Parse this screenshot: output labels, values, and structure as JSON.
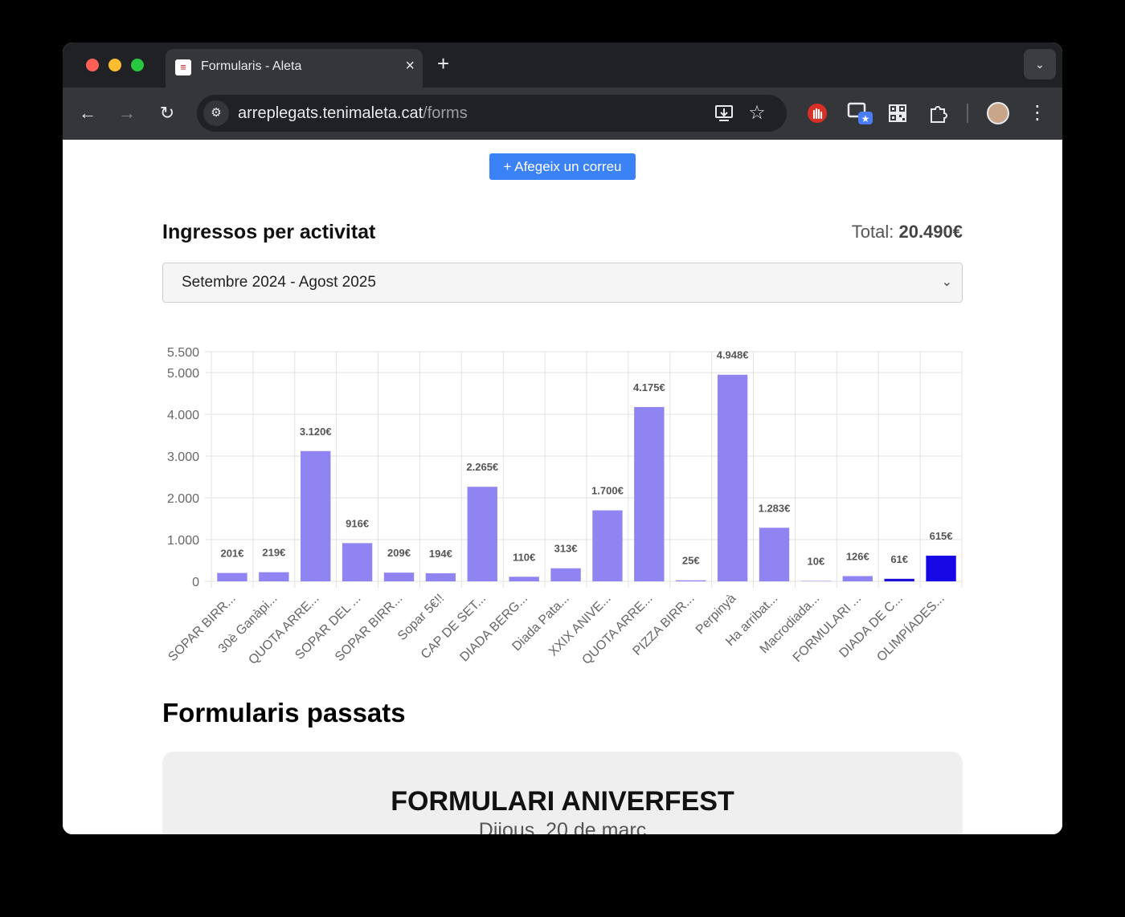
{
  "browser": {
    "tab_title": "Formularis - Aleta",
    "url_host": "arreplegats.tenimaleta.cat",
    "url_path": "/forms",
    "favicon_glyph": "≡"
  },
  "page": {
    "add_button": "+ Afegeix un correu",
    "section_title": "Ingressos per activitat",
    "total_label": "Total:",
    "total_value": "20.490€",
    "period_selected": "Setembre 2024 - Agost 2025",
    "past_title": "Formularis passats",
    "card": {
      "title": "FORMULARI ANIVERFEST",
      "date": "Dijous, 20 de març"
    }
  },
  "colors": {
    "bar": "#8f84f1",
    "bar_dark": "#1d0fd8",
    "bar_last": "#1808e6",
    "accent_button": "#3b82f6"
  },
  "chart_data": {
    "type": "bar",
    "categories": [
      "SOPAR BIRR...",
      "30è Ganàpi...",
      "QUOTA ARRE...",
      "SOPAR DEL ...",
      "SOPAR BIRR...",
      "Sopar 5€!!",
      "CAP DE SET...",
      "DIADA BERG...",
      "Diada Pata...",
      "XXIX ANIVE...",
      "QUOTA ARRE...",
      "PIZZA BIRR...",
      "Perpinyà",
      "Ha arribat...",
      "Macrodiada...",
      "FORMULARI ...",
      "DIADA DE C...",
      "OLIMPÍADES..."
    ],
    "values": [
      201,
      219,
      3120,
      916,
      209,
      194,
      2265,
      110,
      313,
      1700,
      4175,
      25,
      4948,
      1283,
      10,
      126,
      61,
      615
    ],
    "data_labels": [
      "201€",
      "219€",
      "3.120€",
      "916€",
      "209€",
      "194€",
      "2.265€",
      "110€",
      "313€",
      "1.700€",
      "4.175€",
      "25€",
      "4.948€",
      "1.283€",
      "10€",
      "126€",
      "61€",
      "615€"
    ],
    "ylim": [
      0,
      5500
    ],
    "yticks": [
      0,
      1000,
      2000,
      3000,
      4000,
      5000,
      5500
    ],
    "ytick_labels": [
      "0",
      "1.000",
      "2.000",
      "3.000",
      "4.000",
      "5.000",
      "5.500"
    ],
    "grid": true,
    "legend": "none"
  }
}
